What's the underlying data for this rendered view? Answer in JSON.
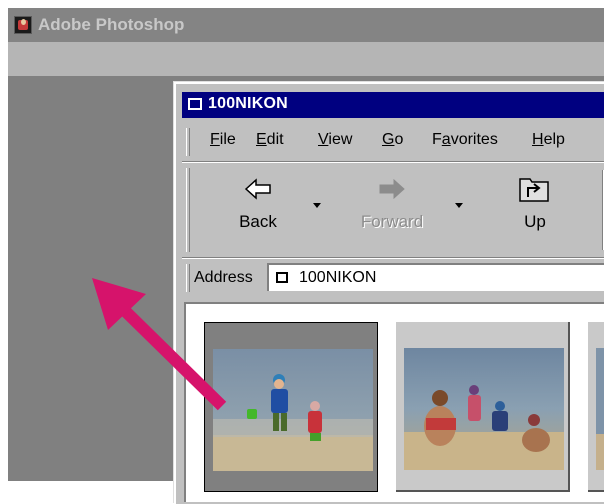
{
  "app": {
    "title": "Adobe Photoshop"
  },
  "window": {
    "title": "100NIKON",
    "menu": [
      {
        "label": "File",
        "hotkey_index": 0
      },
      {
        "label": "Edit",
        "hotkey_index": 0
      },
      {
        "label": "View",
        "hotkey_index": 0
      },
      {
        "label": "Go",
        "hotkey_index": 0
      },
      {
        "label": "Favorites",
        "hotkey_index": 1
      },
      {
        "label": "Help",
        "hotkey_index": 0
      }
    ],
    "toolbar": {
      "back_label": "Back",
      "forward_label": "Forward",
      "up_label": "Up"
    },
    "address": {
      "label": "Address",
      "value": "100NIKON"
    }
  },
  "colors": {
    "arrow": "#d6136b",
    "titlebar_active": "#000080",
    "photoshop_bg": "#808080"
  },
  "icons": {
    "app_icon": "photoshop-eye-icon",
    "folder_icon": "folder-icon",
    "back_icon": "back-arrow-icon",
    "forward_icon": "forward-arrow-icon",
    "up_icon": "up-folder-icon"
  }
}
